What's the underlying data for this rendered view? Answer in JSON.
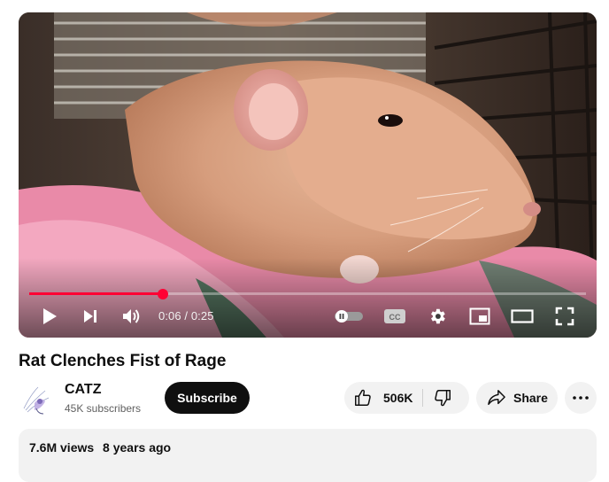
{
  "video": {
    "current_time": "0:06",
    "duration": "0:25",
    "time_display": "0:06 / 0:25",
    "progress": 0.24,
    "progress_color": "#ff0033",
    "controls": {
      "play": "play-icon",
      "next": "next-icon",
      "volume": "volume-icon",
      "autoplay": "autoplay-toggle-icon",
      "captions": "captions-icon",
      "settings": "gear-icon",
      "miniplayer": "miniplayer-icon",
      "theater": "theater-icon",
      "fullscreen": "fullscreen-icon"
    },
    "captions_label": "CC"
  },
  "title": "Rat Clenches Fist of Rage",
  "channel": {
    "name": "CATZ",
    "subscribers": "45K subscribers"
  },
  "actions": {
    "subscribe_label": "Subscribe",
    "like_count": "506K",
    "share_label": "Share"
  },
  "description": {
    "views": "7.6M views",
    "age": "8 years ago"
  }
}
